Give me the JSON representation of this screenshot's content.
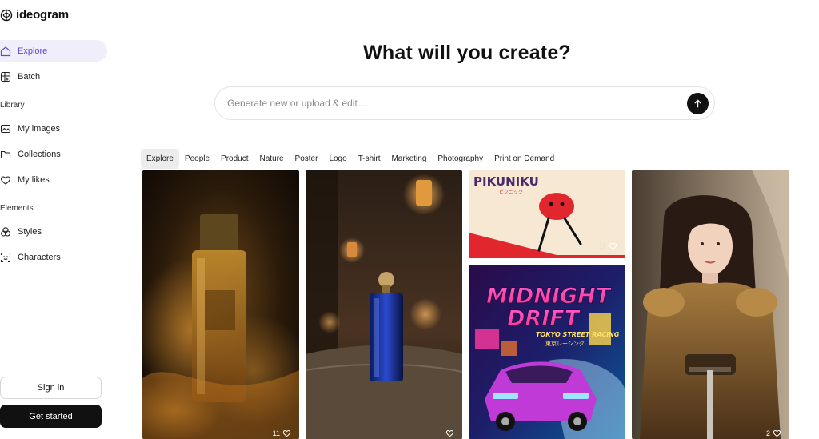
{
  "app": {
    "name": "ideogram"
  },
  "sidebar": {
    "nav": [
      {
        "label": "Explore",
        "icon": "home-icon",
        "active": true
      },
      {
        "label": "Batch",
        "icon": "batch-icon",
        "active": false
      }
    ],
    "library_label": "Library",
    "library": [
      {
        "label": "My images",
        "icon": "images-icon"
      },
      {
        "label": "Collections",
        "icon": "folder-icon"
      },
      {
        "label": "My likes",
        "icon": "heart-icon"
      }
    ],
    "elements_label": "Elements",
    "elements": [
      {
        "label": "Styles",
        "icon": "styles-icon"
      },
      {
        "label": "Characters",
        "icon": "characters-icon"
      }
    ],
    "sign_in": "Sign in",
    "get_started": "Get started"
  },
  "main": {
    "title": "What will you create?",
    "search_placeholder": "Generate new or upload & edit...",
    "tabs": [
      "Explore",
      "People",
      "Product",
      "Nature",
      "Poster",
      "Logo",
      "T-shirt",
      "Marketing",
      "Photography",
      "Print on Demand"
    ],
    "active_tab": "Explore"
  },
  "gallery": [
    {
      "subject": "golden perfume bottle in swirling golden smoke",
      "likes": "11"
    },
    {
      "subject": "blue perfume bottle in lantern-lit room",
      "likes": ""
    },
    {
      "subject": "PIKUNIKU red character poster",
      "title_text": "PIKUNIKU",
      "sub_text": "ピクニック",
      "likes": "11"
    },
    {
      "subject": "MIDNIGHT DRIFT street racing poster",
      "title_text": "MIDNIGHT DRIFT",
      "sub_text": "TOKYO STREET RACING",
      "jp_text": "東京レーシング",
      "likes": ""
    },
    {
      "subject": "woman in bronze armor holding sword",
      "likes": "2"
    }
  ],
  "colors": {
    "accent": "#5b4bd1",
    "active_bg": "#f1eefb",
    "dark": "#111111"
  }
}
